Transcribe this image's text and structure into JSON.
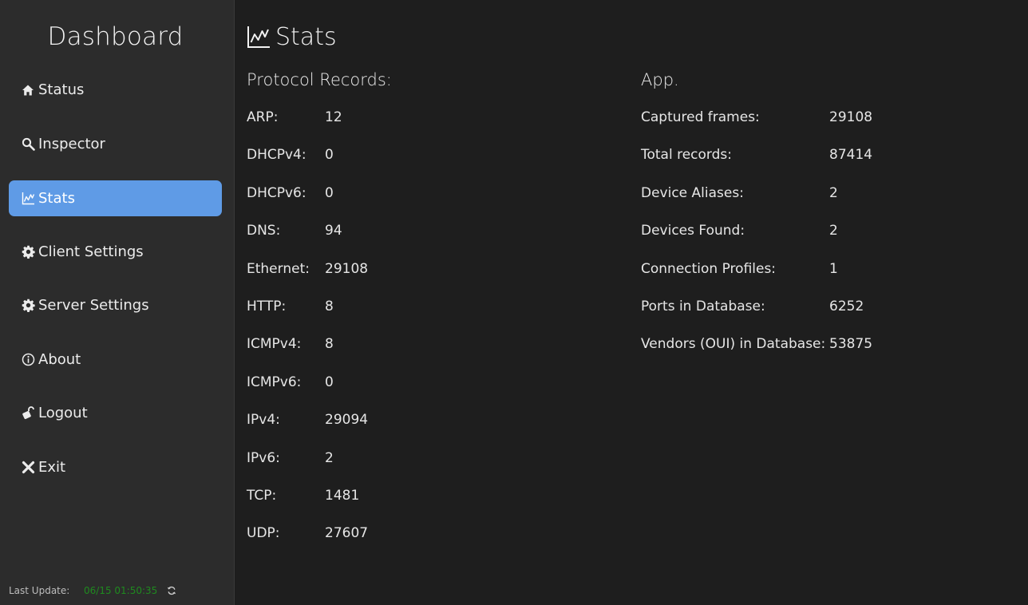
{
  "sidebar": {
    "title": "Dashboard",
    "items": [
      {
        "label": "Status",
        "icon": "home-icon"
      },
      {
        "label": "Inspector",
        "icon": "search-icon"
      },
      {
        "label": "Stats",
        "icon": "chart-line-icon",
        "active": true
      },
      {
        "label": "Client Settings",
        "icon": "gear-icon"
      },
      {
        "label": "Server Settings",
        "icon": "gear-icon"
      },
      {
        "label": "About",
        "icon": "info-icon"
      },
      {
        "label": "Logout",
        "icon": "unlock-icon"
      },
      {
        "label": "Exit",
        "icon": "close-icon"
      }
    ],
    "footer": {
      "label": "Last Update:",
      "time": "06/15 01:50:35",
      "refresh_icon": "refresh-icon"
    }
  },
  "main": {
    "title": "Stats",
    "protocol": {
      "title": "Protocol Records:",
      "rows": [
        {
          "label": "ARP:",
          "value": "12"
        },
        {
          "label": "DHCPv4:",
          "value": "0"
        },
        {
          "label": "DHCPv6:",
          "value": "0"
        },
        {
          "label": "DNS:",
          "value": "94"
        },
        {
          "label": "Ethernet:",
          "value": "29108"
        },
        {
          "label": "HTTP:",
          "value": "8"
        },
        {
          "label": "ICMPv4:",
          "value": "8"
        },
        {
          "label": "ICMPv6:",
          "value": "0"
        },
        {
          "label": "IPv4:",
          "value": "29094"
        },
        {
          "label": "IPv6:",
          "value": "2"
        },
        {
          "label": "TCP:",
          "value": "1481"
        },
        {
          "label": "UDP:",
          "value": "27607"
        }
      ]
    },
    "app": {
      "title": "App.",
      "rows": [
        {
          "label": "Captured frames:",
          "value": "29108"
        },
        {
          "label": "Total records:",
          "value": "87414"
        },
        {
          "label": "Device Aliases:",
          "value": "2"
        },
        {
          "label": "Devices Found:",
          "value": "2"
        },
        {
          "label": "Connection Profiles:",
          "value": "1"
        },
        {
          "label": "Ports in Database:",
          "value": "6252"
        },
        {
          "label": "Vendors (OUI) in Database:",
          "value": "53875"
        }
      ]
    }
  },
  "colors": {
    "background": "#1e1e1e",
    "sidebar": "#2c2c2c",
    "accent": "#5f9be6",
    "timestamp": "#1f8a1f"
  }
}
